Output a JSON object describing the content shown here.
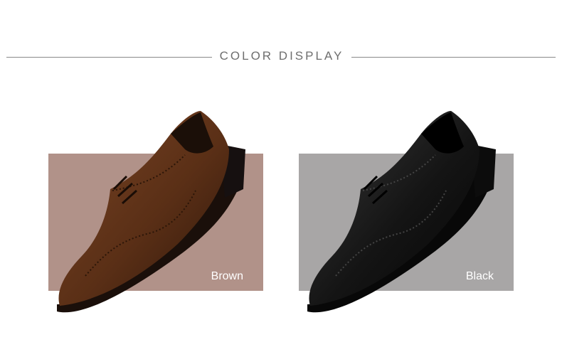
{
  "header": {
    "title": "COLOR DISPLAY"
  },
  "swatches": [
    {
      "label": "Brown",
      "bg_color": "#b19289",
      "shoe_color": "#5a2f16",
      "shoe_icon": "brogue-shoe-icon"
    },
    {
      "label": "Black",
      "bg_color": "#a8a6a6",
      "shoe_color": "#141414",
      "shoe_icon": "brogue-shoe-icon"
    }
  ]
}
